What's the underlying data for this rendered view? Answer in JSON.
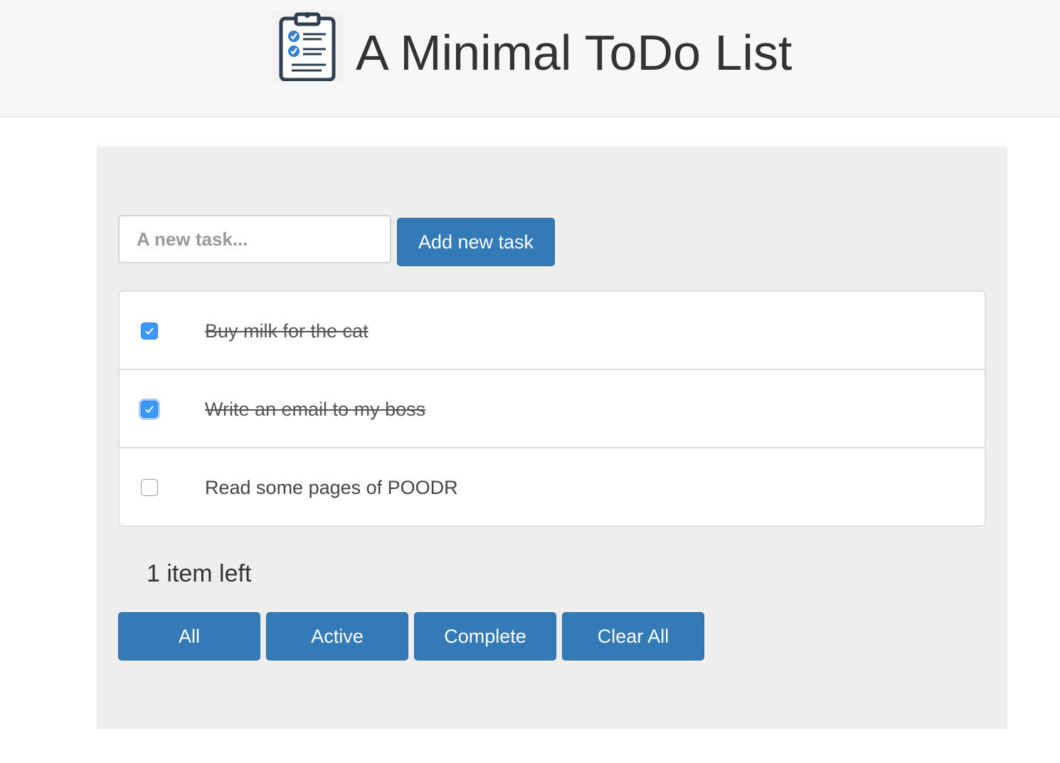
{
  "header": {
    "logo_icon": "clipboard-checklist-icon",
    "title": "A Minimal ToDo List"
  },
  "new_task": {
    "placeholder": "A new task...",
    "value": "",
    "add_label": "Add new task"
  },
  "tasks": [
    {
      "text": "Buy milk for the cat",
      "completed": true
    },
    {
      "text": "Write an email to my boss",
      "completed": true
    },
    {
      "text": "Read some pages of POODR",
      "completed": false
    }
  ],
  "status": {
    "items_left": "1 item left"
  },
  "filters": {
    "all": "All",
    "active": "Active",
    "complete": "Complete",
    "clear_all": "Clear All"
  },
  "colors": {
    "primary": "#337ab7",
    "checkbox_checked": "#3b99fc",
    "panel_bg": "#eeeeee",
    "header_bg": "#f7f7f7"
  }
}
